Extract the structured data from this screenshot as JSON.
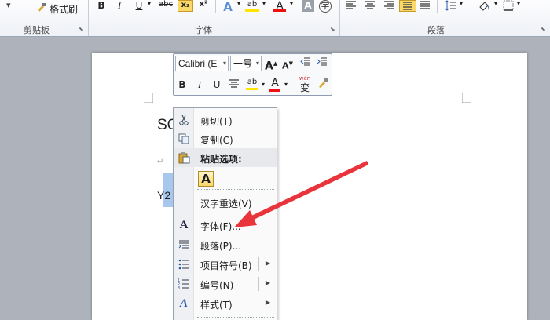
{
  "ribbon": {
    "format_painter": "格式刷",
    "clipboard_label": "剪贴板",
    "font_label": "字体",
    "paragraph_label": "段落",
    "btn_bold": "B",
    "btn_italic": "I",
    "btn_underline": "U",
    "btn_strike": "abc",
    "btn_subscript": "x₂",
    "btn_superscript": "x²",
    "btn_font_color": "A",
    "btn_char_shading": "A",
    "btn_enclose": "字",
    "btn_highlight": "ab"
  },
  "document": {
    "line1": "SO",
    "line2": "Y2"
  },
  "mini_toolbar": {
    "font_name": "Calibri (E",
    "font_size": "一号",
    "btn_bold": "B",
    "btn_italic": "I",
    "btn_underline": "U",
    "btn_highlight": "ab",
    "btn_font_color": "A",
    "btn_grow": "A",
    "btn_shrink": "A",
    "btn_phonetic": "wén",
    "btn_phonetic_char": "变"
  },
  "context_menu": {
    "cut": "剪切(T)",
    "copy": "复制(C)",
    "paste_options": "粘贴选项:",
    "paste_keep_text": "A",
    "hanzi_reselect": "汉字重选(V)",
    "font": "字体(F)...",
    "paragraph": "段落(P)...",
    "bullets": "项目符号(B)",
    "numbering": "编号(N)",
    "styles": "样式(T)"
  },
  "colors": {
    "ribbon_bg": "#eef1f6",
    "selected_button": "#fbd86a",
    "annotation_arrow": "#e8343a",
    "selection": "#a7c8ec"
  }
}
